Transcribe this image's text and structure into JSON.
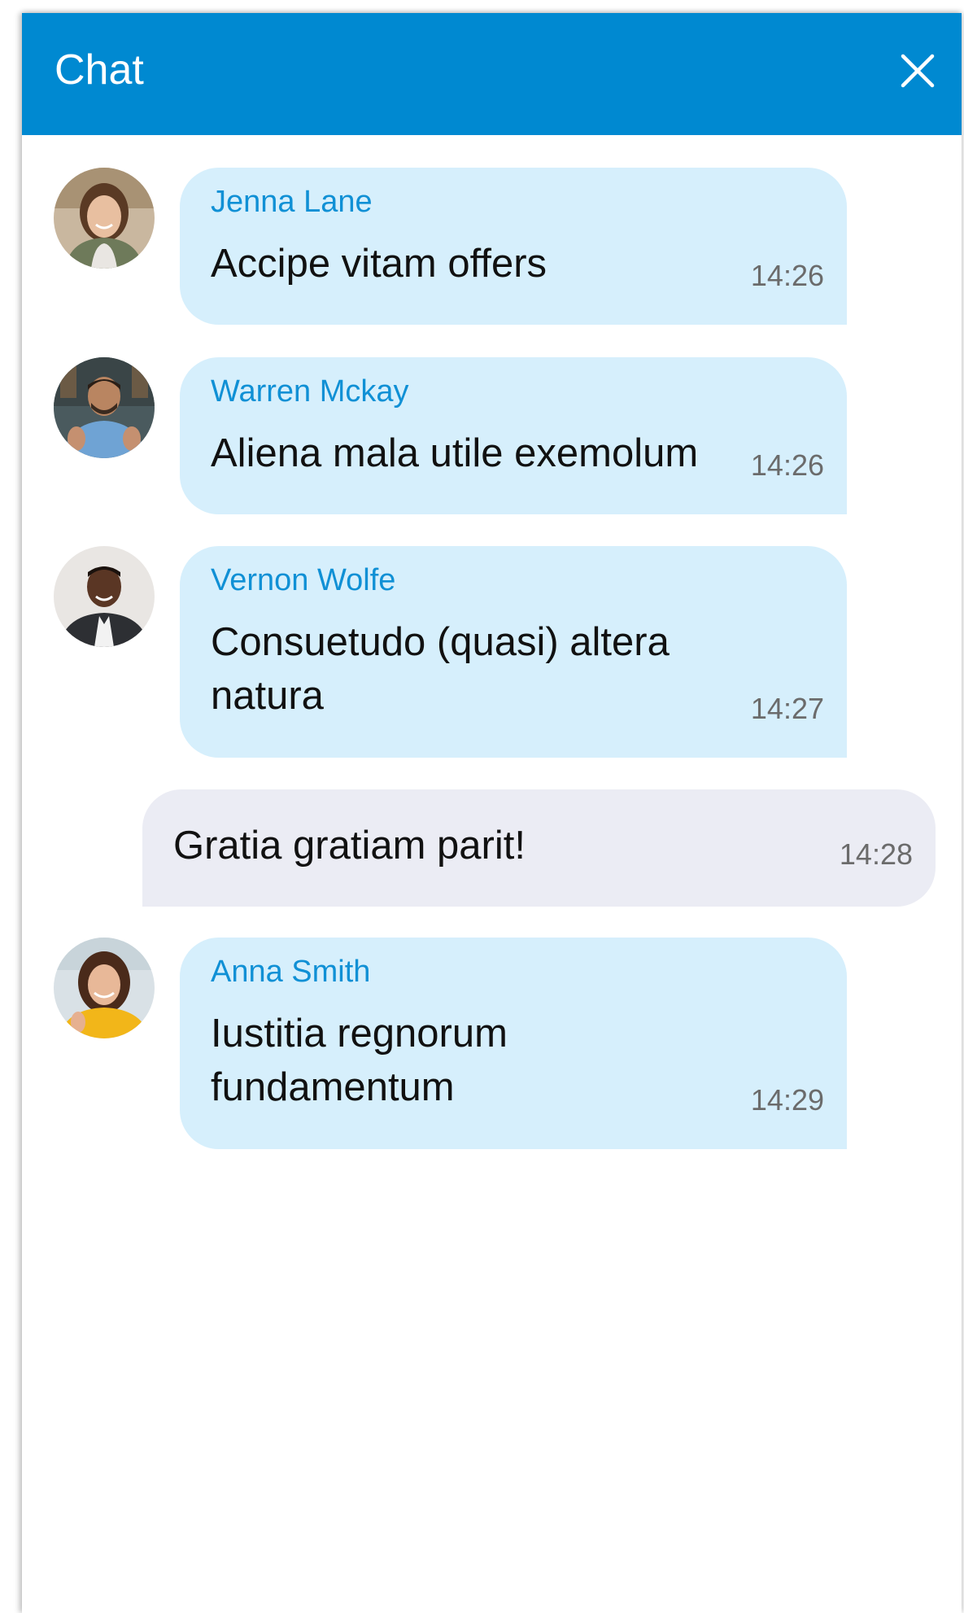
{
  "header": {
    "title": "Chat",
    "close_icon": "close-icon",
    "background_color": "#0089d1"
  },
  "messages": [
    {
      "sender": "Jenna Lane",
      "text": "Accipe vitam offers",
      "time": "14:26",
      "avatar_icon": "avatar-jenna-lane"
    },
    {
      "sender": "Warren Mckay",
      "text": "Aliena mala utile exemolum",
      "time": "14:26",
      "avatar_icon": "avatar-warren-mckay"
    },
    {
      "sender": "Vernon Wolfe",
      "text": "Consuetudo (quasi) altera natura",
      "time": "14:27",
      "avatar_icon": "avatar-vernon-wolfe"
    },
    {
      "own": true,
      "text": "Gratia gratiam parit!",
      "time": "14:28"
    },
    {
      "sender": "Anna Smith",
      "text": "Iustitia regnorum fundamentum",
      "time": "14:29",
      "avatar_icon": "avatar-anna-smith"
    }
  ],
  "colors": {
    "incoming_bubble": "#d6effc",
    "outgoing_bubble": "#ebecf4",
    "sender_name": "#1090d5",
    "timestamp": "#6b6b6b"
  }
}
